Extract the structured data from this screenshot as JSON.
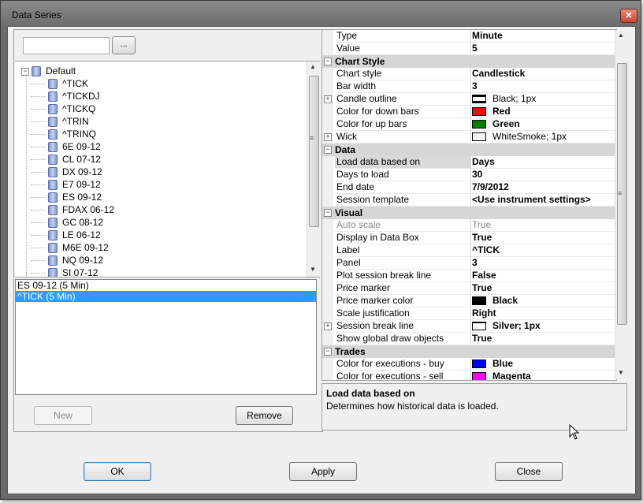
{
  "window": {
    "title": "Data Series",
    "close_glyph": "✕"
  },
  "left": {
    "search": {
      "value": "",
      "placeholder": ""
    },
    "browse_label": "...",
    "tree": {
      "root": "Default",
      "items": [
        "^TICK",
        "^TICKDJ",
        "^TICKQ",
        "^TRIN",
        "^TRINQ",
        "6E 09-12",
        "CL 07-12",
        "DX 09-12",
        "E7 09-12",
        "ES 09-12",
        "FDAX 06-12",
        "GC 08-12",
        "LE 06-12",
        "M6E 09-12",
        "NQ 09-12",
        "SI 07-12"
      ]
    },
    "series": [
      "ES 09-12 (5 Min)",
      "^TICK (5 Min)"
    ],
    "new_label": "New",
    "remove_label": "Remove"
  },
  "props": {
    "type_key": "Type",
    "type_val": "Minute",
    "value_key": "Value",
    "value_val": "5",
    "cat_chart_style": "Chart Style",
    "chart_style_key": "Chart style",
    "chart_style_val": "Candlestick",
    "bar_width_key": "Bar width",
    "bar_width_val": "3",
    "candle_outline_key": "Candle outline",
    "candle_outline_val": "Black; 1px",
    "color_down_key": "Color for down bars",
    "color_down_val": "Red",
    "color_up_key": "Color for up bars",
    "color_up_val": "Green",
    "wick_key": "Wick",
    "wick_val": "WhiteSmoke; 1px",
    "cat_data": "Data",
    "load_based_key": "Load data based on",
    "load_based_val": "Days",
    "days_to_load_key": "Days to load",
    "days_to_load_val": "30",
    "end_date_key": "End date",
    "end_date_val": "7/9/2012",
    "session_template_key": "Session template",
    "session_template_val": "<Use instrument settings>",
    "cat_visual": "Visual",
    "auto_scale_key": "Auto scale",
    "auto_scale_val": "True",
    "display_data_box_key": "Display in Data Box",
    "display_data_box_val": "True",
    "label_key": "Label",
    "label_val": "^TICK",
    "panel_key": "Panel",
    "panel_val": "3",
    "plot_session_break_key": "Plot session break line",
    "plot_session_break_val": "False",
    "price_marker_key": "Price marker",
    "price_marker_val": "True",
    "price_marker_color_key": "Price marker color",
    "price_marker_color_val": "Black",
    "scale_just_key": "Scale justification",
    "scale_just_val": "Right",
    "session_break_line_key": "Session break line",
    "session_break_line_val": "Silver; 1px",
    "show_global_draw_key": "Show global draw objects",
    "show_global_draw_val": "True",
    "cat_trades": "Trades",
    "exec_buy_key": "Color for executions - buy",
    "exec_buy_val": "Blue",
    "exec_sell_key": "Color for executions - sell",
    "exec_sell_val": "Magenta"
  },
  "colors": {
    "black": "#000000",
    "red": "#ff0000",
    "green": "#008000",
    "whitesmoke": "#f5f5f5",
    "silver": "#c0c0c0",
    "blue": "#0000ff",
    "magenta": "#ff00ff",
    "selection": "#3399ff"
  },
  "description": {
    "title": "Load data based on",
    "text": "Determines how historical data is loaded."
  },
  "buttons": {
    "ok": "OK",
    "apply": "Apply",
    "close": "Close"
  }
}
